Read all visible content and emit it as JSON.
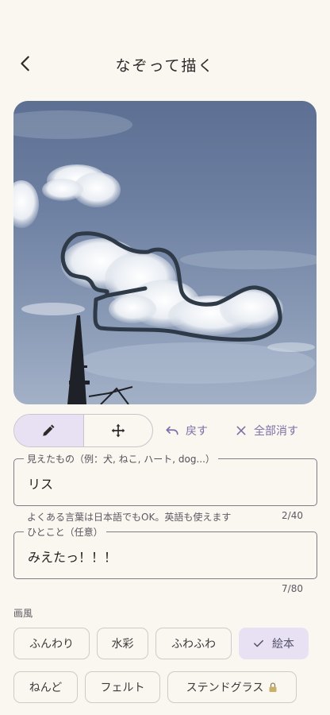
{
  "header": {
    "title": "なぞって描く"
  },
  "icons": {
    "back": "arrow-back-icon",
    "pencil": "pencil-icon",
    "move": "move-arrows-icon",
    "undo": "undo-icon",
    "clear": "close-icon",
    "check": "check-icon",
    "lock": "lock-icon"
  },
  "toolbar": {
    "undo_label": "戻す",
    "clear_label": "全部消す"
  },
  "seen_field": {
    "label": "見えたもの（例：犬, ねこ, ハート, dog...）",
    "value": "リス",
    "hint": "よくある言葉は日本語でもOK。英語も使えます",
    "counter": "2/40"
  },
  "comment_field": {
    "label": "ひとこと（任意）",
    "value": "みえたっ！！！",
    "counter": "7/80"
  },
  "style": {
    "label": "画風",
    "chips": [
      {
        "label": "ふんわり",
        "selected": false
      },
      {
        "label": "水彩",
        "selected": false
      },
      {
        "label": "ふわふわ",
        "selected": false
      },
      {
        "label": "絵本",
        "selected": true
      },
      {
        "label": "ねんど",
        "selected": false
      },
      {
        "label": "フェルト",
        "selected": false
      },
      {
        "label": "ステンドグラス",
        "selected": false,
        "locked": true
      }
    ]
  },
  "colors": {
    "accent": "#7c70a8",
    "selected_bg": "#e7e1f3",
    "background": "#faf6f0",
    "stroke": "#2f3a48"
  }
}
